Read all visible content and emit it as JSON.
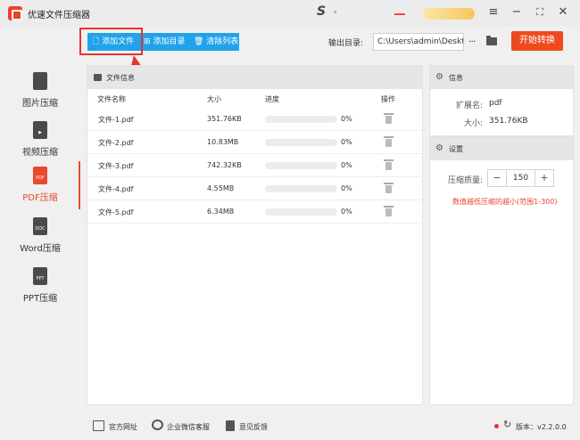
{
  "app": {
    "title": "优速文件压缩器"
  },
  "titlebar": {
    "badge_text": "·",
    "s_logo": "S",
    "extra_glyph": "⸗"
  },
  "sidebar": {
    "items": [
      {
        "label": "图片压缩",
        "icon": "image-file-icon",
        "icon_text": ""
      },
      {
        "label": "视频压缩",
        "icon": "video-file-icon",
        "icon_text": "▶"
      },
      {
        "label": "PDF压缩",
        "icon": "pdf-file-icon",
        "icon_text": "PDF",
        "active": true
      },
      {
        "label": "Word压缩",
        "icon": "word-file-icon",
        "icon_text": "DOC"
      },
      {
        "label": "PPT压缩",
        "icon": "ppt-file-icon",
        "icon_text": "PPT"
      }
    ]
  },
  "toolbar": {
    "add_file": "添加文件",
    "add_dir": "添加目录",
    "clear_list": "清除列表",
    "output_label": "输出目录:",
    "output_path": "C:\\Users\\admin\\Desktop",
    "more": "···",
    "start": "开始转换"
  },
  "file_panel": {
    "title": "文件信息",
    "columns": [
      "文件名称",
      "大小",
      "进度",
      "操作"
    ],
    "rows": [
      {
        "name": "文件-1.pdf",
        "size": "351.76KB",
        "progress": "0%"
      },
      {
        "name": "文件-2.pdf",
        "size": "10.83MB",
        "progress": "0%"
      },
      {
        "name": "文件-3.pdf",
        "size": "742.32KB",
        "progress": "0%"
      },
      {
        "name": "文件-4.pdf",
        "size": "4.55MB",
        "progress": "0%"
      },
      {
        "name": "文件-5.pdf",
        "size": "6.34MB",
        "progress": "0%"
      }
    ]
  },
  "info_panel": {
    "title": "信息",
    "ext_label": "扩展名:",
    "ext_value": "pdf",
    "size_label": "大小:",
    "size_value": "351.76KB"
  },
  "settings_panel": {
    "title": "设置",
    "quality_label": "压缩质量:",
    "quality_value": "150",
    "minus": "−",
    "plus": "+",
    "hint": "数值越低压缩的越小(范围1-300)"
  },
  "footer": {
    "website": "官方网址",
    "wechat": "企业微信客服",
    "feedback": "意见反馈",
    "version": "版本：v2.2.0.0"
  },
  "colors": {
    "accent": "#20a3ea",
    "brand": "#e94a2e",
    "start": "#ef4a1e"
  }
}
